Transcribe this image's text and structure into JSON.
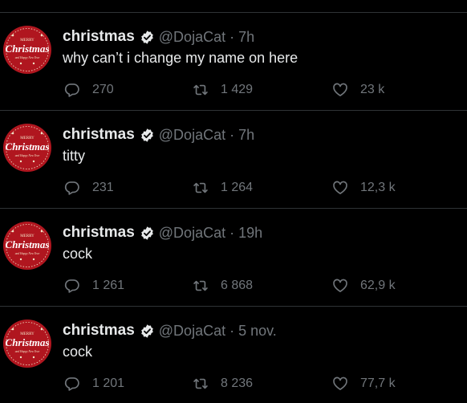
{
  "colors": {
    "background": "#000000",
    "divider": "#2f3336",
    "primary_text": "#e7e9ea",
    "secondary_text": "#71767b",
    "avatar_red": "#b0161f",
    "verified_badge": "#e7e9ea"
  },
  "icons": {
    "reply": "reply-icon",
    "retweet": "retweet-icon",
    "like": "heart-icon",
    "verified": "verified-badge-icon"
  },
  "tweets": [
    {
      "name": "christmas",
      "handle": "@DojaCat",
      "separator": "·",
      "time": "7h",
      "text": "why can’t i change my name on here",
      "replies": "270",
      "retweets": "1 429",
      "likes": "23 k",
      "avatar": {
        "top": "MERRY",
        "main": "Christmas",
        "bottom": "and Happy New Year"
      }
    },
    {
      "name": "christmas",
      "handle": "@DojaCat",
      "separator": "·",
      "time": "7h",
      "text": "titty",
      "replies": "231",
      "retweets": "1 264",
      "likes": "12,3 k",
      "avatar": {
        "top": "MERRY",
        "main": "Christmas",
        "bottom": "and Happy New Year"
      }
    },
    {
      "name": "christmas",
      "handle": "@DojaCat",
      "separator": "·",
      "time": "19h",
      "text": "cock",
      "replies": "1 261",
      "retweets": "6 868",
      "likes": "62,9 k",
      "avatar": {
        "top": "MERRY",
        "main": "Christmas",
        "bottom": "and Happy New Year"
      }
    },
    {
      "name": "christmas",
      "handle": "@DojaCat",
      "separator": "·",
      "time": "5 nov.",
      "text": "cock",
      "replies": "1 201",
      "retweets": "8 236",
      "likes": "77,7 k",
      "avatar": {
        "top": "MERRY",
        "main": "Christmas",
        "bottom": "and Happy New Year"
      }
    }
  ]
}
